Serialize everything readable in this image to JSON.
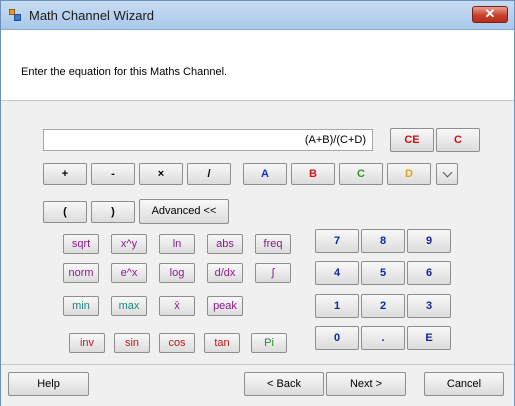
{
  "window": {
    "title": "Math Channel Wizard",
    "close_label": "✕"
  },
  "header": {
    "instruction": "Enter the equation for this Maths Channel."
  },
  "equation": {
    "value": "(A+B)/(C+D)"
  },
  "buttons": {
    "ce": "CE",
    "c": "C",
    "plus": "+",
    "minus": "-",
    "multiply": "×",
    "divide": "/",
    "a": "A",
    "b": "B",
    "c_channel": "C",
    "d": "D",
    "open_paren": "(",
    "close_paren": ")",
    "advanced": "Advanced <<"
  },
  "colors": {
    "a": "#1a2fbf",
    "b": "#d41818",
    "c": "#2a9a2a",
    "d": "#e0a020"
  },
  "functions": {
    "sqrt": "sqrt",
    "xy": "x^y",
    "ln": "ln",
    "abs": "abs",
    "freq": "freq",
    "norm": "norm",
    "ex": "e^x",
    "log": "log",
    "ddx": "d/dx",
    "integral": "∫",
    "min": "min",
    "max": "max",
    "xbar": "x̄",
    "peak": "peak",
    "inv": "inv",
    "sin": "sin",
    "cos": "cos",
    "tan": "tan",
    "pi": "Pi"
  },
  "numpad": [
    "7",
    "8",
    "9",
    "4",
    "5",
    "6",
    "1",
    "2",
    "3",
    "0",
    ".",
    "E"
  ],
  "footer": {
    "help": "Help",
    "back": "< Back",
    "next": "Next >",
    "cancel": "Cancel"
  }
}
